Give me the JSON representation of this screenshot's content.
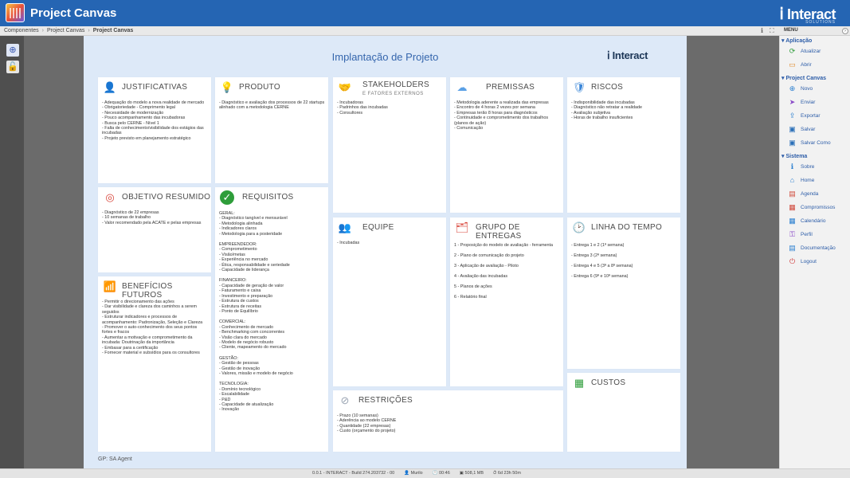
{
  "app": {
    "title": "Project Canvas",
    "brand": "Interact",
    "brand_sub": "SOLUTIONS"
  },
  "breadcrumbs": [
    "Componentes",
    "Project Canvas",
    "Project Canvas"
  ],
  "menu_label": "MENU",
  "canvas": {
    "title": "Implantação de Projeto",
    "brand": "Interact",
    "footer": "GP: SA Agent",
    "cards": {
      "justificativas": {
        "title": "JUSTIFICATIVAS",
        "items": [
          "- Adequação do modelo a nova realidade de mercado",
          "- Obrigatoriedade - Comprimento legal",
          "- Necessidade de modernização",
          "- Pouco acompanhamento das incubadoras",
          "- Busca pelo CERNE - Nível 1",
          "- Falta de conhecimento/visibilidade dos estágios das incubadas",
          "- Projeto previsto em planejamento estratégico"
        ]
      },
      "produto": {
        "title": "PRODUTO",
        "items": [
          "- Diagnóstico e avaliação dos processos de 22 startups alinhado com a metodologia CERNE"
        ]
      },
      "stakeholders": {
        "title": "STAKEHOLDERS",
        "subtitle": "E FATORES EXTERNOS",
        "items": [
          "- Incubadoras",
          "- Padrinhos das incubadas",
          "- Consultores"
        ]
      },
      "premissas": {
        "title": "PREMISSAS",
        "items": [
          "- Metodologia aderente a realizada das empresas",
          "- Encontro de 4 horas 2 vezes por semana",
          "- Empresas terão 8 horas para diagnósticos",
          "- Continuidade e comprometimento dos trabalhos (planos de ação)",
          "- Comunicação"
        ]
      },
      "riscos": {
        "title": "RISCOS",
        "items": [
          "- Indisponibilidade das incubadas",
          "- Diagnóstico não retratar a realidade",
          "- Avaliação subjetiva",
          "- Horas de trabalho insuficientes"
        ]
      },
      "objetivo": {
        "title": "OBJETIVO RESUMIDO",
        "items": [
          "- Diagnóstico de 22 empresas",
          "- 10 semanas de trabalho",
          "- Valor recomendado pela ACATE e pelas empresas"
        ]
      },
      "requisitos": {
        "title": "REQUISITOS",
        "groups": [
          {
            "name": "GERAL:",
            "items": [
              "- Diagnóstico tangível e mensurável",
              "- Metodologia alinhada",
              "- Indicadores claros",
              "- Metodologia para a posteridade"
            ]
          },
          {
            "name": "EMPREENDEDOR:",
            "items": [
              "- Comprometimento",
              "- Visão/metas",
              "- Experiência no mercado",
              "- Ética, responsabilidade e seriedade",
              "- Capacidade de liderança"
            ]
          },
          {
            "name": "FINANCEIRO:",
            "items": [
              "- Capacidade de geração de valor",
              "- Faturamento e caixa",
              "- Investimento e preparação",
              "- Estrutura de custos",
              "- Estrutura de receitas",
              "- Ponto de Equilíbrio"
            ]
          },
          {
            "name": "COMERCIAL:",
            "items": [
              "- Conhecimento de mercado",
              "- Benchmarking com concorrentes",
              "- Visão clara do mercado",
              "- Modelo de negócio robusto",
              "- Cliente, mapeamento do mercado"
            ]
          },
          {
            "name": "GESTÃO:",
            "items": [
              "- Gestão de pessoas",
              "- Gestão de inovação",
              "- Valores, missão e modelo de negócio"
            ]
          },
          {
            "name": "TECNOLOGIA:",
            "items": [
              "- Domínio tecnológico",
              "- Escalabilidade",
              "- P&D",
              "- Capacidade de atualização",
              "- Inovação"
            ]
          }
        ]
      },
      "equipe": {
        "title": "EQUIPE",
        "items": [
          "- Incubadas"
        ]
      },
      "entregas": {
        "title": "GRUPO DE ENTREGAS",
        "items": [
          "1 - Proposição do modelo de avaliação - ferramenta",
          "2 - Plano de comunicação do projeto",
          "3 - Aplicação de avaliação - Piloto",
          "4 - Avaliação das incubadas",
          "5 - Planos de ações",
          "6 - Relatório final"
        ]
      },
      "linha": {
        "title": "LINHA DO TEMPO",
        "items": [
          "- Entrega 1 e 2 (1ª semana)",
          "- Entrega 3 (2ª semana)",
          "- Entrega 4 e 5 (3ª a 8ª semana)",
          "- Entrega 6 (9ª e 10ª semana)"
        ]
      },
      "beneficios": {
        "title": "BENEFÍCIOS FUTUROS",
        "items": [
          "- Permitir o direcionamento das ações",
          "- Dar visibilidade e clareza dos caminhos a serem seguidos",
          "- Estruturar indicadores e processos de acompanhamento: Padronização, Seleção e Clareza",
          "- Promover o auto-conhecimento dos seus pontos fortes e fracos",
          "- Aumentar a motivação e comprometimento da incubada: Doutrinação da importância",
          "- Embasar para a certificação",
          "- Fornecer material e subsídios para os consultores"
        ]
      },
      "restricoes": {
        "title": "RESTRIÇÕES",
        "items": [
          "- Prazo (10 semanas)",
          "- Aderência ao modelo CERNE",
          "- Quantidade (22 empresas)",
          "- Custo (orçamento do projeto)"
        ]
      },
      "custos": {
        "title": "CUSTOS",
        "items": []
      }
    }
  },
  "menu": {
    "sections": [
      {
        "title": "Aplicação",
        "items": [
          {
            "label": "Atualizar",
            "icon": "refresh-icon",
            "color": "#2e9d3a"
          },
          {
            "label": "Abrir",
            "icon": "folder-icon",
            "color": "#e08a2a"
          }
        ]
      },
      {
        "title": "Project Canvas",
        "items": [
          {
            "label": "Novo",
            "icon": "add-icon",
            "color": "#2a7fd0"
          },
          {
            "label": "Enviar",
            "icon": "send-icon",
            "color": "#8a4bc8"
          },
          {
            "label": "Exportar",
            "icon": "export-icon",
            "color": "#2a7fd0"
          },
          {
            "label": "Salvar",
            "icon": "save-icon",
            "color": "#2a6fb8"
          },
          {
            "label": "Salvar Como",
            "icon": "save-as-icon",
            "color": "#2a6fb8"
          }
        ]
      },
      {
        "title": "Sistema",
        "items": [
          {
            "label": "Sobre",
            "icon": "info-icon",
            "color": "#2a7fd0"
          },
          {
            "label": "Home",
            "icon": "home-icon",
            "color": "#2a7fd0"
          },
          {
            "label": "Agenda",
            "icon": "agenda-icon",
            "color": "#d04a3a"
          },
          {
            "label": "Compromissos",
            "icon": "appointments-icon",
            "color": "#d0483a"
          },
          {
            "label": "Calendário",
            "icon": "calendar-icon",
            "color": "#2a7fd0"
          },
          {
            "label": "Perfil",
            "icon": "profile-icon",
            "color": "#8a4bc8"
          },
          {
            "label": "Documentação",
            "icon": "docs-icon",
            "color": "#2a7fd0"
          },
          {
            "label": "Logout",
            "icon": "logout-icon",
            "color": "#d03a3a"
          }
        ]
      }
    ]
  },
  "status": {
    "version": "0.0.1 - INTERACT - Build 274.203732 - 00",
    "user": "Murilo",
    "time": "00:46",
    "memory": "508,1 MB",
    "uptime": "6d 23h 50m"
  }
}
